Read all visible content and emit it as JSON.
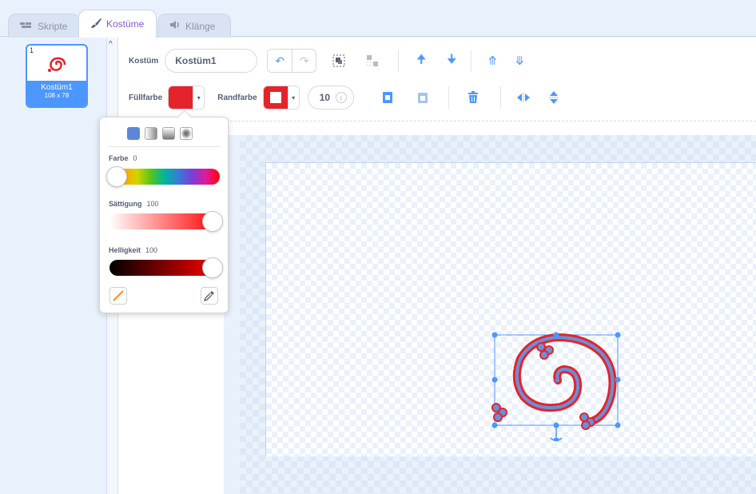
{
  "tabs": [
    {
      "label": "Skripte",
      "icon": "code-icon",
      "active": false
    },
    {
      "label": "Kostüme",
      "icon": "paintbrush-icon",
      "active": true
    },
    {
      "label": "Klänge",
      "icon": "speaker-icon",
      "active": false
    }
  ],
  "costume_list": {
    "items": [
      {
        "index": "1",
        "name": "Kostüm1",
        "size": "108 x 78"
      }
    ]
  },
  "toolbar": {
    "costume_label": "Kostüm",
    "costume_name": "Kostüm1",
    "fill_label": "Füllfarbe",
    "outline_label": "Randfarbe",
    "outline_width": "10",
    "fill_color": "#e6232a",
    "outline_color": "#e6232a"
  },
  "color_picker": {
    "hue_label": "Farbe",
    "hue_value": "0",
    "saturation_label": "Sättigung",
    "saturation_value": "100",
    "brightness_label": "Helligkeit",
    "brightness_value": "100",
    "hue_level": 0,
    "saturation_level": 100,
    "brightness_level": 100
  },
  "colors": {
    "accent": "#4c97ff",
    "tab_active": "#855cd6",
    "red": "#e6232a",
    "spiral_stroke": "#6a8fd8"
  }
}
